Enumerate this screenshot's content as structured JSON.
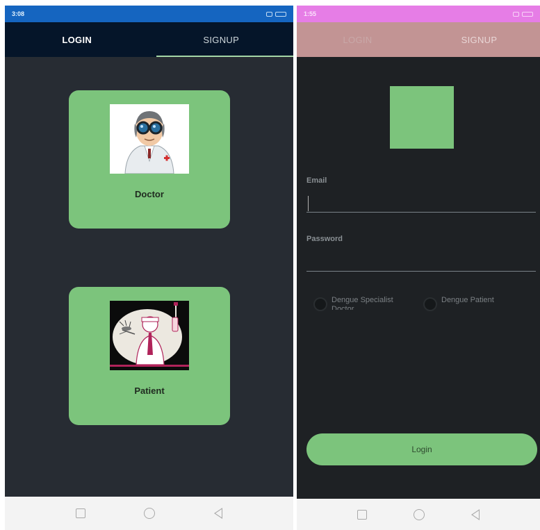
{
  "left": {
    "status": {
      "time": "3:08"
    },
    "tabs": [
      {
        "label": "LOGIN"
      },
      {
        "label": "SIGNUP"
      }
    ],
    "cards": {
      "doctor": {
        "label": "Doctor",
        "icon": "doctor-icon"
      },
      "patient": {
        "label": "Patient",
        "icon": "patient-icon"
      }
    }
  },
  "right": {
    "status": {
      "time": "1:55"
    },
    "tabs": [
      {
        "label": "LOGIN"
      },
      {
        "label": "SIGNUP"
      }
    ],
    "email": {
      "label": "Email",
      "value": ""
    },
    "password": {
      "label": "Password",
      "value": ""
    },
    "radios": [
      {
        "label": "Dengue Specialist Doctor"
      },
      {
        "label": "Dengue Patient"
      }
    ],
    "login_button": "Login"
  },
  "colors": {
    "accent_green": "#7cc47c",
    "left_status": "#1565c0",
    "left_tabbar": "#051529",
    "right_status": "#e67de6",
    "right_tabbar": "#c29494",
    "screen_dark": "#272c33"
  }
}
